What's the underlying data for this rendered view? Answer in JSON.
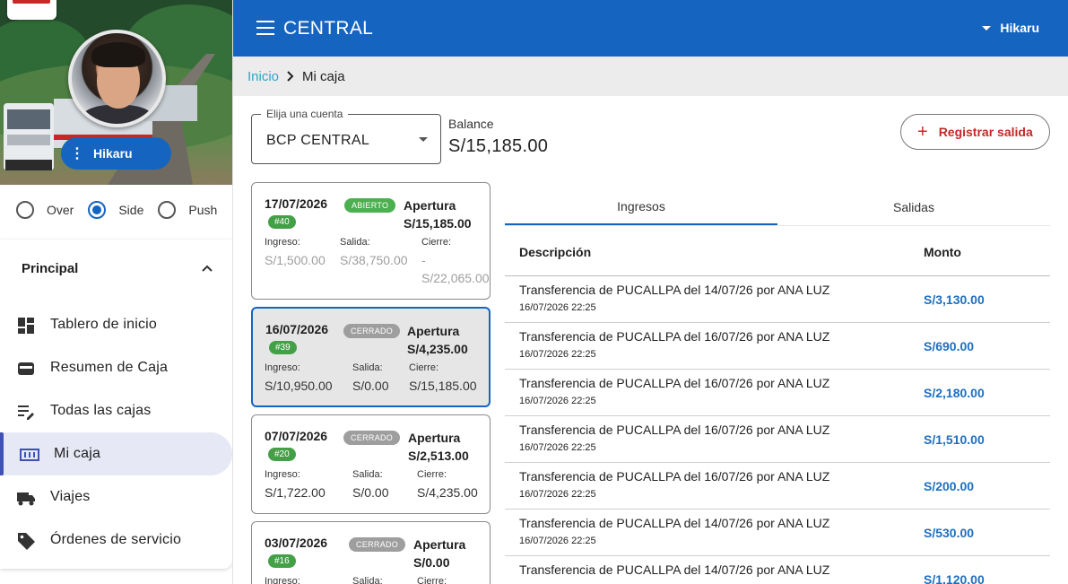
{
  "sidebar": {
    "user_name": "Hikaru",
    "modes": [
      {
        "label": "Over",
        "selected": false
      },
      {
        "label": "Side",
        "selected": true
      },
      {
        "label": "Push",
        "selected": false
      }
    ],
    "section_title": "Principal",
    "items": [
      {
        "label": "Tablero de inicio",
        "icon": "dashboard-icon",
        "active": false
      },
      {
        "label": "Resumen de Caja",
        "icon": "wallet-icon",
        "active": false
      },
      {
        "label": "Todas las cajas",
        "icon": "edit-list-icon",
        "active": false
      },
      {
        "label": "Mi caja",
        "icon": "cash-register-icon",
        "active": true
      },
      {
        "label": "Viajes",
        "icon": "truck-icon",
        "active": false
      },
      {
        "label": "Órdenes de servicio",
        "icon": "tag-icon",
        "active": false
      }
    ]
  },
  "topbar": {
    "title": "CENTRAL",
    "user": "Hikaru"
  },
  "breadcrumb": {
    "home": "Inicio",
    "current": "Mi caja"
  },
  "account": {
    "label": "Elija una cuenta",
    "value": "BCP CENTRAL"
  },
  "balance": {
    "label": "Balance",
    "value": "S/15,185.00"
  },
  "register_button": "Registrar salida",
  "colors": {
    "primary": "#1565c0",
    "danger": "#c62828",
    "open_badge": "#4caf50",
    "closed_badge": "#9e9e9e",
    "amount": "#1e6fbf"
  },
  "cajas": [
    {
      "date": "17/07/2026",
      "number": "#40",
      "status": "ABIERTO",
      "apertura_label": "Apertura",
      "apertura_value": "S/15,185.00",
      "ingreso_label": "Ingreso:",
      "ingreso": "S/1,500.00",
      "salida_label": "Salida:",
      "salida": "S/38,750.00",
      "cierre_label": "Cierre:",
      "cierre_dash": "-",
      "cierre": "S/22,065.00"
    },
    {
      "date": "16/07/2026",
      "number": "#39",
      "status": "CERRADO",
      "apertura_label": "Apertura",
      "apertura_value": "S/4,235.00",
      "ingreso_label": "Ingreso:",
      "ingreso": "S/10,950.00",
      "salida_label": "Salida:",
      "salida": "S/0.00",
      "cierre_label": "Cierre:",
      "cierre": "S/15,185.00"
    },
    {
      "date": "07/07/2026",
      "number": "#20",
      "status": "CERRADO",
      "apertura_label": "Apertura",
      "apertura_value": "S/2,513.00",
      "ingreso_label": "Ingreso:",
      "ingreso": "S/1,722.00",
      "salida_label": "Salida:",
      "salida": "S/0.00",
      "cierre_label": "Cierre:",
      "cierre": "S/4,235.00"
    },
    {
      "date": "03/07/2026",
      "number": "#16",
      "status": "CERRADO",
      "apertura_label": "Apertura",
      "apertura_value": "S/0.00",
      "ingreso_label": "Ingreso:",
      "salida_label": "Salida:",
      "cierre_label": "Cierre:"
    }
  ],
  "tabs": [
    "Ingresos",
    "Salidas"
  ],
  "table": {
    "headers": [
      "Descripción",
      "Monto"
    ],
    "rows": [
      {
        "desc": "Transferencia de PUCALLPA del 14/07/26 por ANA LUZ",
        "ts": "16/07/2026 22:25",
        "amount": "S/3,130.00"
      },
      {
        "desc": "Transferencia de PUCALLPA del 16/07/26 por ANA LUZ",
        "ts": "16/07/2026 22:25",
        "amount": "S/690.00"
      },
      {
        "desc": "Transferencia de PUCALLPA del 16/07/26 por ANA LUZ",
        "ts": "16/07/2026 22:25",
        "amount": "S/2,180.00"
      },
      {
        "desc": "Transferencia de PUCALLPA del 16/07/26 por ANA LUZ",
        "ts": "16/07/2026 22:25",
        "amount": "S/1,510.00"
      },
      {
        "desc": "Transferencia de PUCALLPA del 16/07/26 por ANA LUZ",
        "ts": "16/07/2026 22:25",
        "amount": "S/200.00"
      },
      {
        "desc": "Transferencia de PUCALLPA del 14/07/26 por ANA LUZ",
        "ts": "16/07/2026 22:25",
        "amount": "S/530.00"
      },
      {
        "desc": "Transferencia de PUCALLPA del 14/07/26 por ANA LUZ",
        "amount": "S/1,120.00"
      }
    ]
  }
}
